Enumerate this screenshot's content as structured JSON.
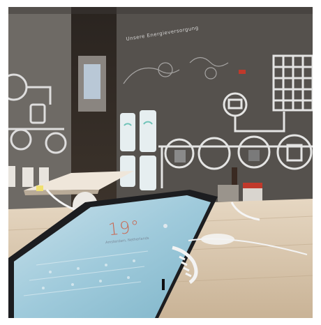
{
  "scene": {
    "description_tags": [
      "smartphone-display",
      "retail-store",
      "energy-diagram-wall"
    ]
  },
  "wall": {
    "title": "Unsere Energieversorgung"
  },
  "phone": {
    "temperature": "19°",
    "location": "Amsterdam, Netherlands"
  },
  "colors": {
    "wall": "#5a5652",
    "table": "#d8c6ad",
    "screen": "#a9cfe0",
    "accent": "#c86a55"
  }
}
